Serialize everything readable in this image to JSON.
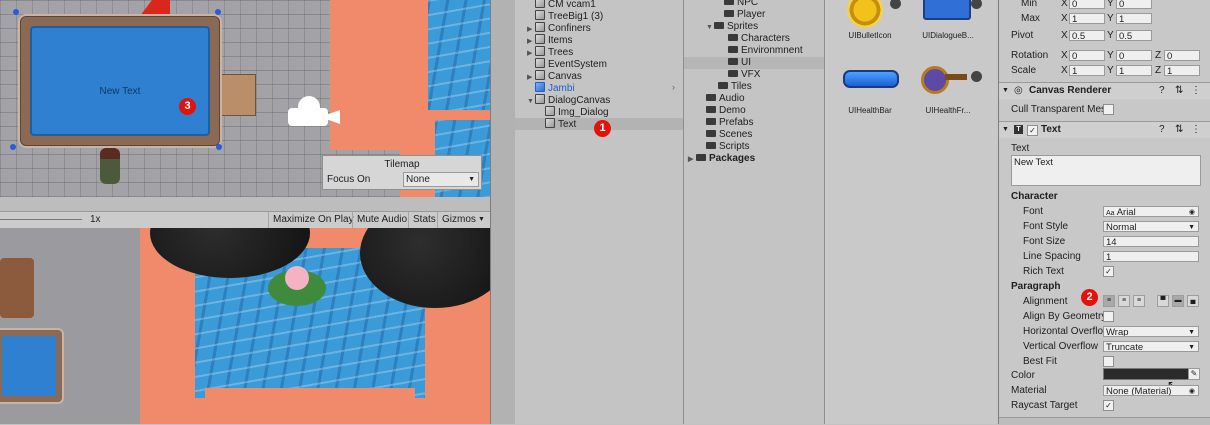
{
  "scene": {
    "dialog_text": "New Text",
    "markers": {
      "one": "1",
      "two": "2",
      "three": "3"
    },
    "tilemap": {
      "title": "Tilemap",
      "focus_label": "Focus On",
      "focus_value": "None"
    }
  },
  "game_toolbar": {
    "scale": "1x",
    "maximize": "Maximize On Play",
    "mute": "Mute Audio",
    "stats": "Stats",
    "gizmos": "Gizmos"
  },
  "hierarchy": {
    "items": [
      {
        "label": "CM vcam1"
      },
      {
        "label": "TreeBig1 (3)"
      },
      {
        "label": "Confiners"
      },
      {
        "label": "Items"
      },
      {
        "label": "Trees"
      },
      {
        "label": "EventSystem"
      },
      {
        "label": "Canvas"
      },
      {
        "label": "Jambi"
      },
      {
        "label": "DialogCanvas"
      },
      {
        "label": "Img_Dialog"
      },
      {
        "label": "Text"
      }
    ]
  },
  "project": {
    "folders": [
      {
        "label": "NPC"
      },
      {
        "label": "Player"
      },
      {
        "label": "Sprites"
      },
      {
        "label": "Characters"
      },
      {
        "label": "Environmnent"
      },
      {
        "label": "UI"
      },
      {
        "label": "VFX"
      },
      {
        "label": "Tiles"
      },
      {
        "label": "Audio"
      },
      {
        "label": "Demo"
      },
      {
        "label": "Prefabs"
      },
      {
        "label": "Scenes"
      },
      {
        "label": "Scripts"
      },
      {
        "label": "Packages"
      }
    ],
    "assets": [
      {
        "label": "UIBulletIcon"
      },
      {
        "label": "UIDialogueB..."
      },
      {
        "label": "UIHealthBar"
      },
      {
        "label": "UIHealthFr..."
      }
    ]
  },
  "inspector": {
    "min_label": "Min",
    "max_label": "Max",
    "pivot_label": "Pivot",
    "rotation_label": "Rotation",
    "scale_label": "Scale",
    "axis_x": "X",
    "axis_y": "Y",
    "axis_z": "Z",
    "min": {
      "x": "0",
      "y": "0"
    },
    "max": {
      "x": "1",
      "y": "1"
    },
    "pivot": {
      "x": "0.5",
      "y": "0.5"
    },
    "rotation": {
      "x": "0",
      "y": "0",
      "z": "0"
    },
    "scale": {
      "x": "1",
      "y": "1",
      "z": "1"
    },
    "canvas_renderer": {
      "title": "Canvas Renderer",
      "cull_label": "Cull Transparent Mes"
    },
    "text": {
      "title": "Text",
      "text_label": "Text",
      "text_value": "New Text",
      "character_heading": "Character",
      "font_label": "Font",
      "font_value": "Arial",
      "font_prefix": "Aa",
      "font_style_label": "Font Style",
      "font_style_value": "Normal",
      "font_size_label": "Font Size",
      "font_size_value": "14",
      "line_spacing_label": "Line Spacing",
      "line_spacing_value": "1",
      "rich_text_label": "Rich Text",
      "paragraph_heading": "Paragraph",
      "alignment_label": "Alignment",
      "align_geometry_label": "Align By Geometry",
      "h_overflow_label": "Horizontal Overflov",
      "h_overflow_value": "Wrap",
      "v_overflow_label": "Vertical Overflow",
      "v_overflow_value": "Truncate",
      "best_fit_label": "Best Fit",
      "color_label": "Color",
      "material_label": "Material",
      "material_value": "None (Material)",
      "raycast_label": "Raycast Target",
      "check_mark": "✓"
    }
  },
  "colors": {
    "marker": "#e3120b",
    "selection": "#b3b3b3",
    "water": "#3b9ad8",
    "sand": "#f08a6a"
  }
}
